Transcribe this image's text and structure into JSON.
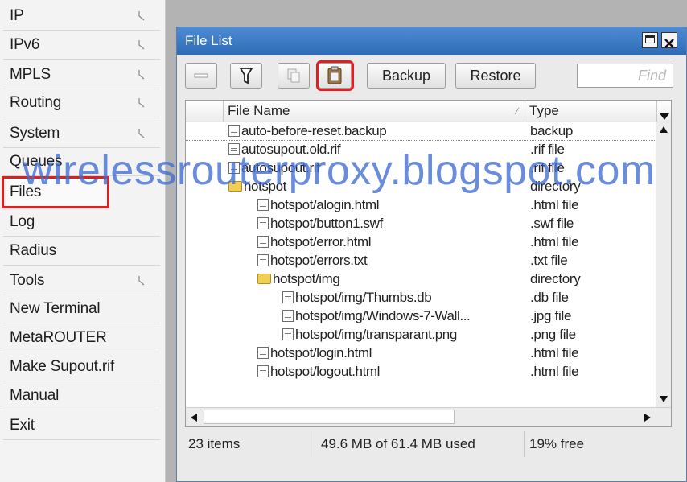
{
  "sidebar": {
    "items": [
      {
        "label": "IP",
        "has_submenu": true
      },
      {
        "label": "IPv6",
        "has_submenu": true
      },
      {
        "label": "MPLS",
        "has_submenu": true
      },
      {
        "label": "Routing",
        "has_submenu": true
      },
      {
        "label": "System",
        "has_submenu": true
      },
      {
        "label": "Queues",
        "has_submenu": false
      },
      {
        "label": "Files",
        "has_submenu": false,
        "highlighted": true
      },
      {
        "label": "Log",
        "has_submenu": false
      },
      {
        "label": "Radius",
        "has_submenu": false
      },
      {
        "label": "Tools",
        "has_submenu": true
      },
      {
        "label": "New Terminal",
        "has_submenu": false
      },
      {
        "label": "MetaROUTER",
        "has_submenu": false
      },
      {
        "label": "Make Supout.rif",
        "has_submenu": false
      },
      {
        "label": "Manual",
        "has_submenu": false
      },
      {
        "label": "Exit",
        "has_submenu": false
      }
    ]
  },
  "window": {
    "title": "File List",
    "toolbar": {
      "remove_icon": "minus-icon",
      "filter_icon": "filter-icon",
      "copy_icon": "copy-icon",
      "paste_icon": "clipboard-icon",
      "backup_label": "Backup",
      "restore_label": "Restore",
      "find_placeholder": "Find"
    },
    "table": {
      "columns": [
        "File Name",
        "Type"
      ],
      "rows": [
        {
          "name": "auto-before-reset.backup",
          "type": "backup",
          "kind": "file",
          "level": 0
        },
        {
          "name": "autosupout.old.rif",
          "type": ".rif file",
          "kind": "file",
          "level": 0
        },
        {
          "name": "autosupout.rif",
          "type": ".rif file",
          "kind": "file",
          "level": 0
        },
        {
          "name": "hotspot",
          "type": "directory",
          "kind": "dir",
          "level": 0
        },
        {
          "name": "hotspot/alogin.html",
          "type": ".html file",
          "kind": "file",
          "level": 1
        },
        {
          "name": "hotspot/button1.swf",
          "type": ".swf file",
          "kind": "file",
          "level": 1
        },
        {
          "name": "hotspot/error.html",
          "type": ".html file",
          "kind": "file",
          "level": 1
        },
        {
          "name": "hotspot/errors.txt",
          "type": ".txt file",
          "kind": "file",
          "level": 1
        },
        {
          "name": "hotspot/img",
          "type": "directory",
          "kind": "dir",
          "level": 1
        },
        {
          "name": "hotspot/img/Thumbs.db",
          "type": ".db file",
          "kind": "file",
          "level": 2
        },
        {
          "name": "hotspot/img/Windows-7-Wall...",
          "type": ".jpg file",
          "kind": "file",
          "level": 2
        },
        {
          "name": "hotspot/img/transparant.png",
          "type": ".png file",
          "kind": "file",
          "level": 2
        },
        {
          "name": "hotspot/login.html",
          "type": ".html file",
          "kind": "file",
          "level": 1
        },
        {
          "name": "hotspot/logout.html",
          "type": ".html file",
          "kind": "file",
          "level": 1
        }
      ]
    },
    "status": {
      "items": "23 items",
      "usage": "49.6 MB of 61.4 MB used",
      "free": "19% free"
    }
  },
  "watermark": "wirelessrouterproxy.blogspot.com",
  "colors": {
    "titlebar": "#3a7bc8",
    "highlight": "#e0201f",
    "watermark": "#406cd2",
    "desktop": "#b3b3b3"
  }
}
